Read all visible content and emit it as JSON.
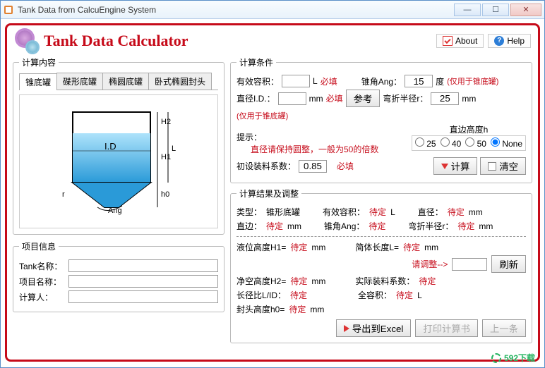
{
  "window": {
    "title": "Tank Data from CalcuEngine System"
  },
  "header": {
    "app_title": "Tank Data Calculator",
    "about": "About",
    "help": "Help"
  },
  "left": {
    "calc_content_legend": "计算内容",
    "tabs": [
      "锥底罐",
      "碟形底罐",
      "椭圆底罐",
      "卧式椭圆封头"
    ],
    "project_legend": "项目信息",
    "tank_name": "Tank名称：",
    "project_name": "项目名称：",
    "calculator_person": "计算人："
  },
  "cond": {
    "legend": "计算条件",
    "eff_vol": "有效容积：",
    "eff_vol_unit": "L",
    "required": "必填",
    "cone_ang": "锥角Ang：",
    "cone_ang_val": "15",
    "cone_ang_unit": "度",
    "only_cone": "(仅用于锥底罐)",
    "diameter": "直径I.D.：",
    "diameter_unit": "mm",
    "ref": "参考",
    "bend_r": "弯折半径r：",
    "bend_r_val": "25",
    "bend_r_unit": "mm",
    "hint": "提示：",
    "hint_text": "直径请保持圆整，一般为50的倍数",
    "edge_h": "直边高度h",
    "radio": {
      "r25": "25",
      "r40": "40",
      "r50": "50",
      "none": "None"
    },
    "init_fill": "初设装料系数：",
    "init_fill_val": "0.85",
    "calc_btn": "计算",
    "clear_btn": "清空"
  },
  "res": {
    "legend": "计算结果及调整",
    "type": "类型：",
    "type_val": "锥形底罐",
    "eff_vol": "有效容积：",
    "pending": "待定",
    "L": "L",
    "diameter": "直径：",
    "mm": "mm",
    "edge": "直边：",
    "cone_ang": "锥角Ang：",
    "bend_r": "弯折半径r：",
    "liquid_h": "液位高度H1=",
    "tube_len": "简体长度L=",
    "adjust": "请调整-->",
    "refresh": "刷新",
    "clear_h": "净空高度H2=",
    "actual_fill": "实际装料系数：",
    "ratio": "长径比L/ID：",
    "total_vol": "全容积：",
    "head_h": "封头高度h0=",
    "export": "导出到Excel",
    "print": "打印计算书",
    "last": "上一条"
  },
  "watermark": "592下载"
}
